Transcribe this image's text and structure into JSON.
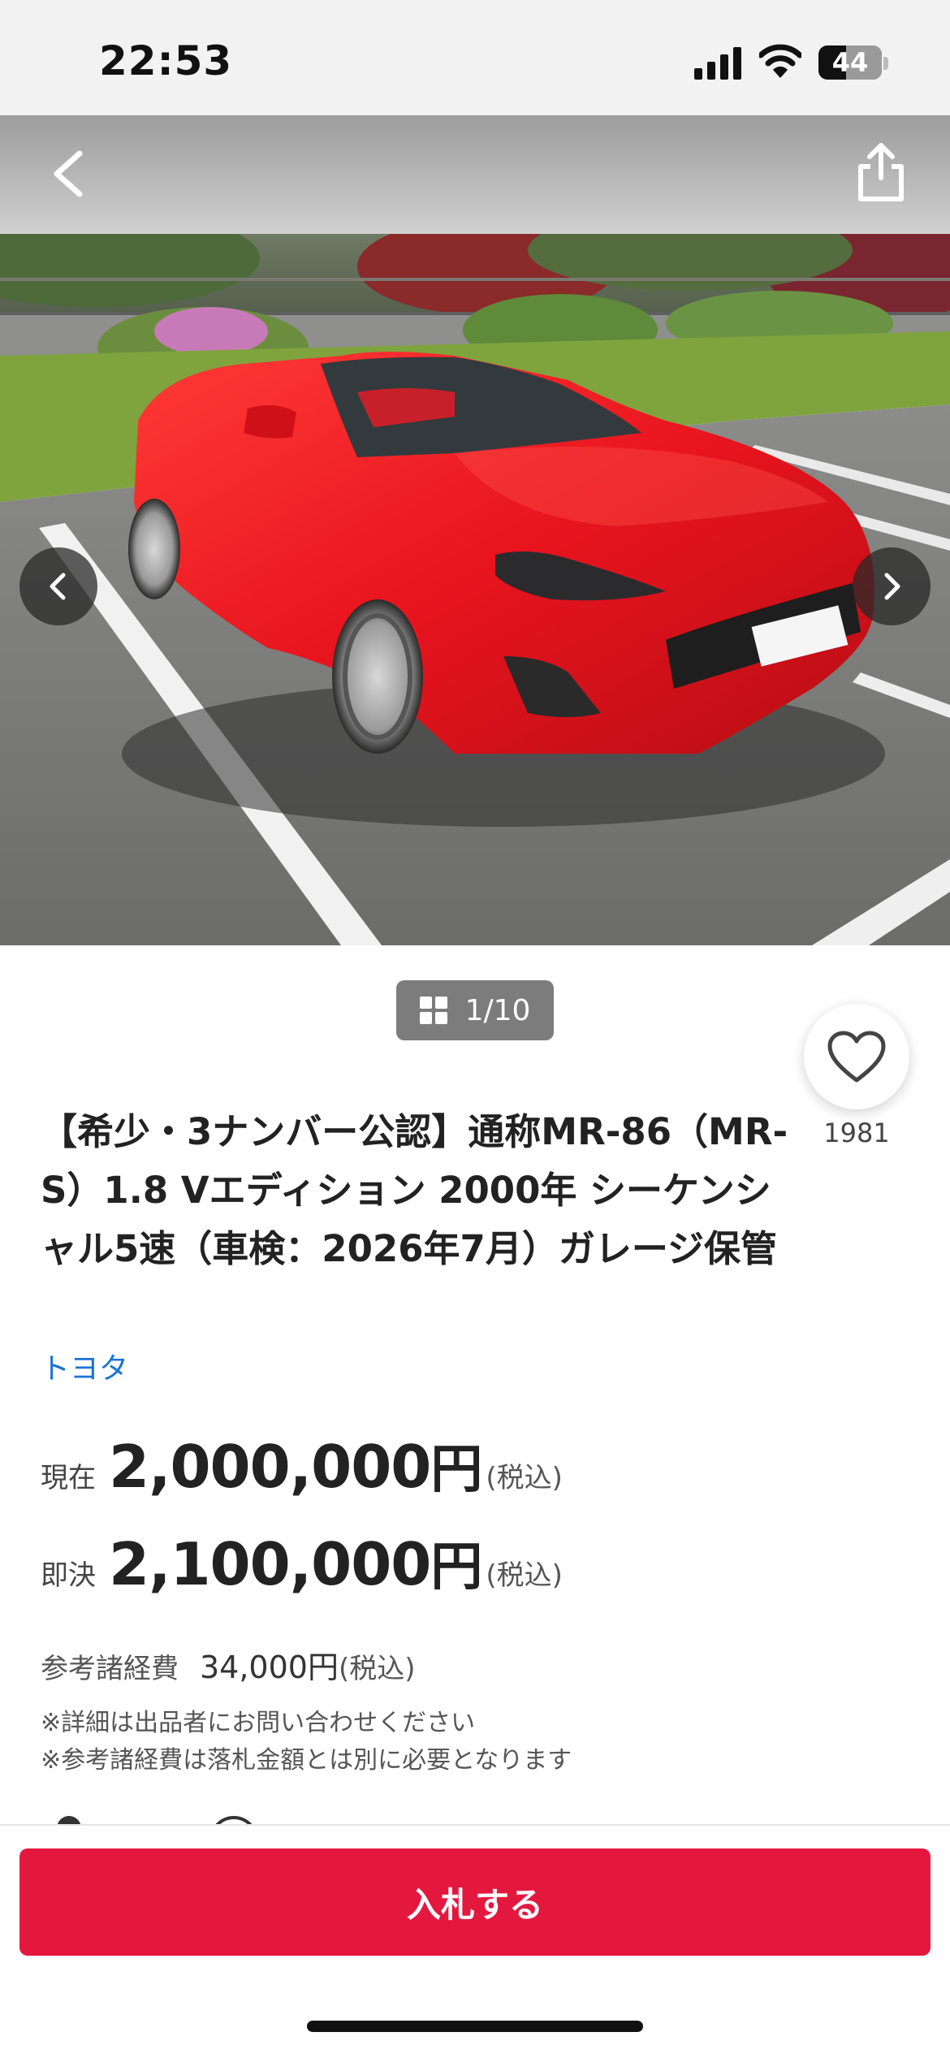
{
  "status_bar": {
    "time": "22:53",
    "battery": "44",
    "battery_level": 0.44
  },
  "gallery": {
    "counter": "1/10",
    "image_alt": "red convertible sports car in parking lot"
  },
  "favorite": {
    "count": "1981"
  },
  "listing": {
    "title": "【希少・3ナンバー公認】通称MR-86（MR-S）1.8 Vエディション 2000年 シーケンシャル5速（車検：2026年7月）ガレージ保管",
    "brand": "トヨタ"
  },
  "prices": {
    "current_label": "現在",
    "current_value": "2,000,000",
    "buyout_label": "即決",
    "buyout_value": "2,100,000",
    "yen": "円",
    "tax_note": "(税込)"
  },
  "fees": {
    "label": "参考諸経費",
    "value": "34,000円",
    "tax_note": "(税込)",
    "note1": "※詳細は出品者にお問い合わせください",
    "note2": "※参考諸経費は落札金額とは別に必要となります"
  },
  "actions": {
    "bid_label": "入札する"
  },
  "colors": {
    "accent": "#e4183f",
    "link": "#1a73d9",
    "car": "#e8141e"
  }
}
